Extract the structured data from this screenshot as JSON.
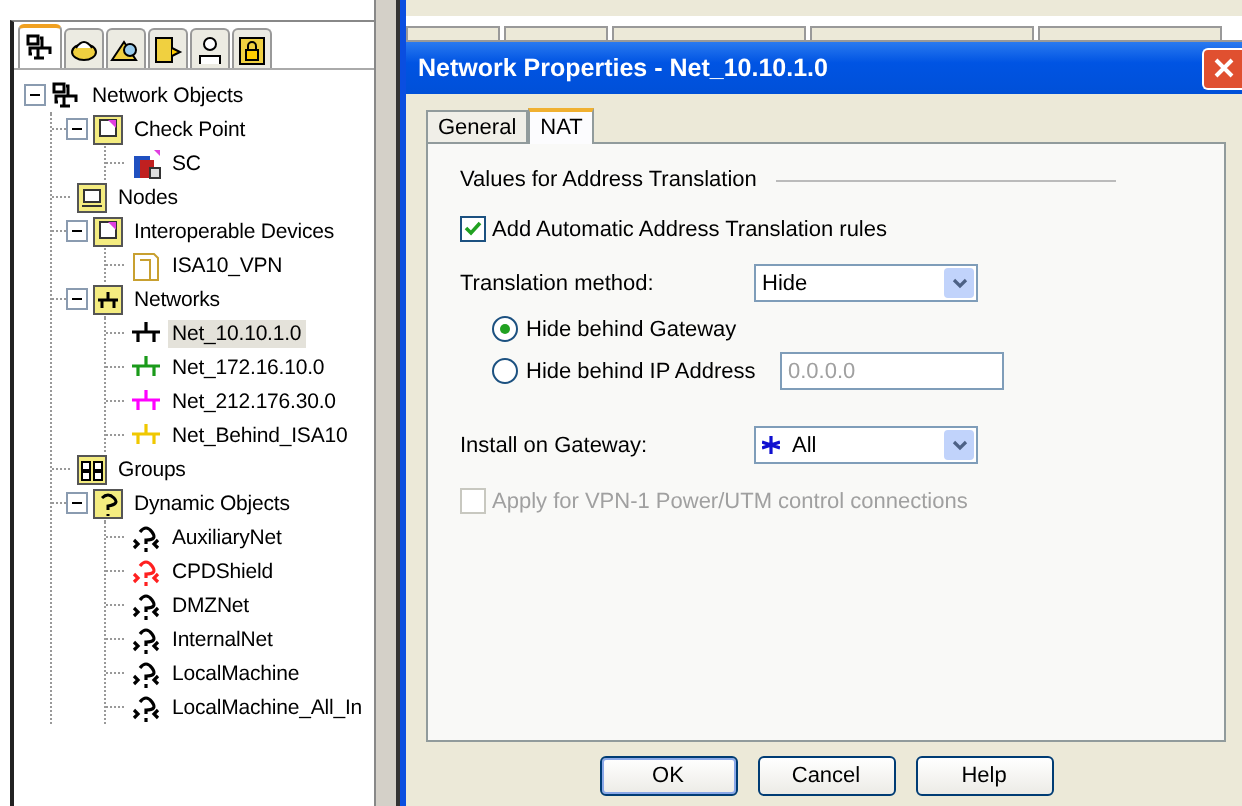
{
  "object_tabs": [
    {
      "kind": "network",
      "selected": true
    },
    {
      "kind": "service",
      "selected": false
    },
    {
      "kind": "resource",
      "selected": false
    },
    {
      "kind": "server",
      "selected": false
    },
    {
      "kind": "user",
      "selected": false
    },
    {
      "kind": "lock",
      "selected": false
    }
  ],
  "tree": [
    {
      "label": "Network Objects",
      "kind": "root",
      "expanded": true,
      "selected": false,
      "children": [
        {
          "label": "Check Point",
          "kind": "folder",
          "expanded": true,
          "selected": false,
          "children": [
            {
              "label": "SC",
              "kind": "gateway",
              "selected": false
            }
          ]
        },
        {
          "label": "Nodes",
          "kind": "nodes",
          "selected": false
        },
        {
          "label": "Interoperable Devices",
          "kind": "folder",
          "expanded": true,
          "selected": false,
          "children": [
            {
              "label": "ISA10_VPN",
              "kind": "device",
              "selected": false
            }
          ]
        },
        {
          "label": "Networks",
          "kind": "networks",
          "expanded": true,
          "selected": false,
          "children": [
            {
              "label": "Net_10.10.1.0",
              "kind": "network",
              "color": "#000000",
              "selected": true
            },
            {
              "label": "Net_172.16.10.0",
              "kind": "network",
              "color": "#1a9a1a",
              "selected": false
            },
            {
              "label": "Net_212.176.30.0",
              "kind": "network",
              "color": "#ff00ff",
              "selected": false
            },
            {
              "label": "Net_Behind_ISA10",
              "kind": "network",
              "color": "#f0c800",
              "selected": false
            }
          ]
        },
        {
          "label": "Groups",
          "kind": "groups",
          "selected": false
        },
        {
          "label": "Dynamic Objects",
          "kind": "dynamic-folder",
          "expanded": true,
          "selected": false,
          "children": [
            {
              "label": "AuxiliaryNet",
              "kind": "dynamic",
              "color": "#000000",
              "selected": false
            },
            {
              "label": "CPDShield",
              "kind": "dynamic",
              "color": "#ff2020",
              "selected": false
            },
            {
              "label": "DMZNet",
              "kind": "dynamic",
              "color": "#000000",
              "selected": false
            },
            {
              "label": "InternalNet",
              "kind": "dynamic",
              "color": "#000000",
              "selected": false
            },
            {
              "label": "LocalMachine",
              "kind": "dynamic",
              "color": "#000000",
              "selected": false
            },
            {
              "label": "LocalMachine_All_In",
              "kind": "dynamic",
              "color": "#000000",
              "selected": false
            }
          ]
        }
      ]
    }
  ],
  "dialog": {
    "title": "Network Properties - Net_10.10.1.0",
    "tabs": [
      {
        "label": "General",
        "selected": false
      },
      {
        "label": "NAT",
        "selected": true
      }
    ],
    "section_title": "Values for Address Translation",
    "auto_rules": {
      "label": "Add Automatic Address Translation rules",
      "checked": true,
      "disabled": false
    },
    "translation_method": {
      "label": "Translation method:",
      "value": "Hide"
    },
    "hide_options": [
      {
        "label": "Hide behind Gateway",
        "selected": true
      },
      {
        "label": "Hide behind IP Address",
        "selected": false,
        "field": {
          "value": "0.0.0.0",
          "disabled": true
        }
      }
    ],
    "install_on_gateway": {
      "label": "Install on Gateway:",
      "value": "All"
    },
    "vpn_option": {
      "label": "Apply for VPN-1 Power/UTM control connections",
      "checked": false,
      "disabled": true
    },
    "buttons": [
      {
        "label": "OK",
        "default": true
      },
      {
        "label": "Cancel",
        "default": false
      },
      {
        "label": "Help",
        "default": false
      }
    ]
  }
}
